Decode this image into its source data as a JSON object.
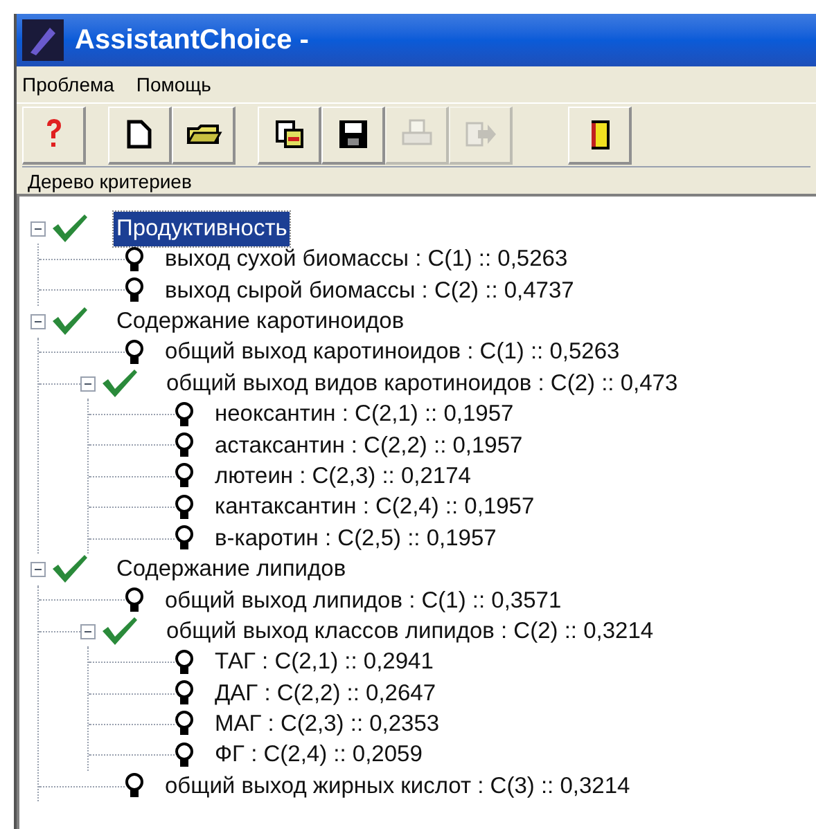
{
  "window": {
    "title": "AssistantChoice -"
  },
  "menu": [
    "Проблема",
    "Помощь"
  ],
  "toolbar": [
    {
      "kind": "help",
      "disabled": false
    },
    {
      "kind": "new",
      "disabled": false
    },
    {
      "kind": "open",
      "disabled": false
    },
    {
      "kind": "copy",
      "disabled": false
    },
    {
      "kind": "save",
      "disabled": false
    },
    {
      "kind": "print",
      "disabled": true
    },
    {
      "kind": "export",
      "disabled": true
    },
    {
      "kind": "exit",
      "disabled": false
    }
  ],
  "panel": {
    "title": "Дерево критериев"
  },
  "tree": [
    {
      "kind": "criterion",
      "label": "Продуктивность",
      "selected": true,
      "expanded": true,
      "children": [
        {
          "kind": "leaf",
          "label": "выход сухой биомассы : C(1) :: 0,5263",
          "selected": false
        },
        {
          "kind": "leaf",
          "label": "выход сырой биомассы : C(2) :: 0,4737",
          "selected": false
        }
      ]
    },
    {
      "kind": "criterion",
      "label": "Содержание каротиноидов",
      "selected": false,
      "expanded": true,
      "children": [
        {
          "kind": "leaf",
          "label": "общий выход каротиноидов : C(1) :: 0,5263",
          "selected": false
        },
        {
          "kind": "criterion",
          "label": "общий выход видов каротиноидов : C(2) :: 0,473",
          "selected": false,
          "expanded": true,
          "children": [
            {
              "kind": "leaf",
              "label": "неоксантин : C(2,1) :: 0,1957",
              "selected": false
            },
            {
              "kind": "leaf",
              "label": "астаксантин : C(2,2) :: 0,1957",
              "selected": false
            },
            {
              "kind": "leaf",
              "label": "лютеин : C(2,3) :: 0,2174",
              "selected": false
            },
            {
              "kind": "leaf",
              "label": "кантаксантин : C(2,4) :: 0,1957",
              "selected": false
            },
            {
              "kind": "leaf",
              "label": "в-каротин : C(2,5) :: 0,1957",
              "selected": false
            }
          ]
        }
      ]
    },
    {
      "kind": "criterion",
      "label": "Содержание липидов",
      "selected": false,
      "expanded": true,
      "children": [
        {
          "kind": "leaf",
          "label": "общий выход липидов : C(1) :: 0,3571",
          "selected": false
        },
        {
          "kind": "criterion",
          "label": "общий выход классов липидов : C(2) :: 0,3214",
          "selected": false,
          "expanded": true,
          "children": [
            {
              "kind": "leaf",
              "label": "ТАГ : C(2,1) :: 0,2941",
              "selected": false
            },
            {
              "kind": "leaf",
              "label": "ДАГ : C(2,2) :: 0,2647",
              "selected": false
            },
            {
              "kind": "leaf",
              "label": "МАГ : C(2,3) :: 0,2353",
              "selected": false
            },
            {
              "kind": "leaf",
              "label": "ФГ : C(2,4) :: 0,2059",
              "selected": false
            }
          ]
        },
        {
          "kind": "leaf",
          "label": "общий выход жирных кислот : C(3) :: 0,3214",
          "selected": false
        }
      ]
    }
  ]
}
